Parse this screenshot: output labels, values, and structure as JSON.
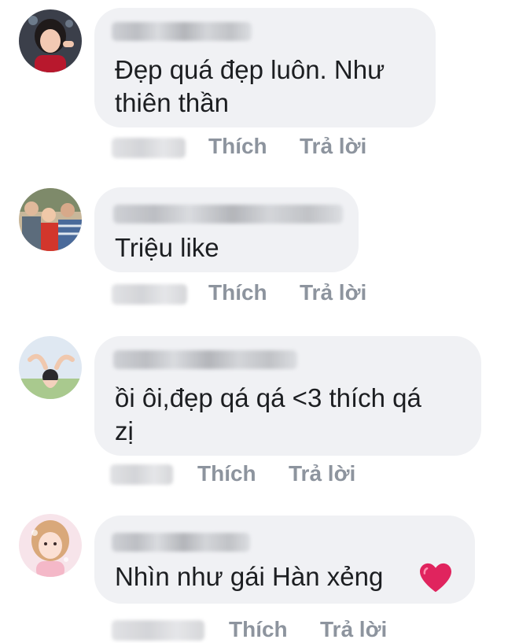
{
  "comments": [
    {
      "text": "Đẹp quá đẹp luôn. Như\nthiên thần",
      "like_label": "Thích",
      "reply_label": "Trả lời"
    },
    {
      "text": "Triệu like",
      "like_label": "Thích",
      "reply_label": "Trả lời"
    },
    {
      "text": "ồi ôi,đẹp qá qá <3 thích qá\nzị",
      "like_label": "Thích",
      "reply_label": "Trả lời"
    },
    {
      "text": "Nhìn như gái Hàn xẻng",
      "like_label": "Thích",
      "reply_label": "Trả lời",
      "emoji": "red-heart-icon"
    }
  ],
  "colors": {
    "bubble": "#f0f1f4",
    "text": "#1c1e21",
    "action": "#8d949e",
    "heart": "#e0245e"
  }
}
